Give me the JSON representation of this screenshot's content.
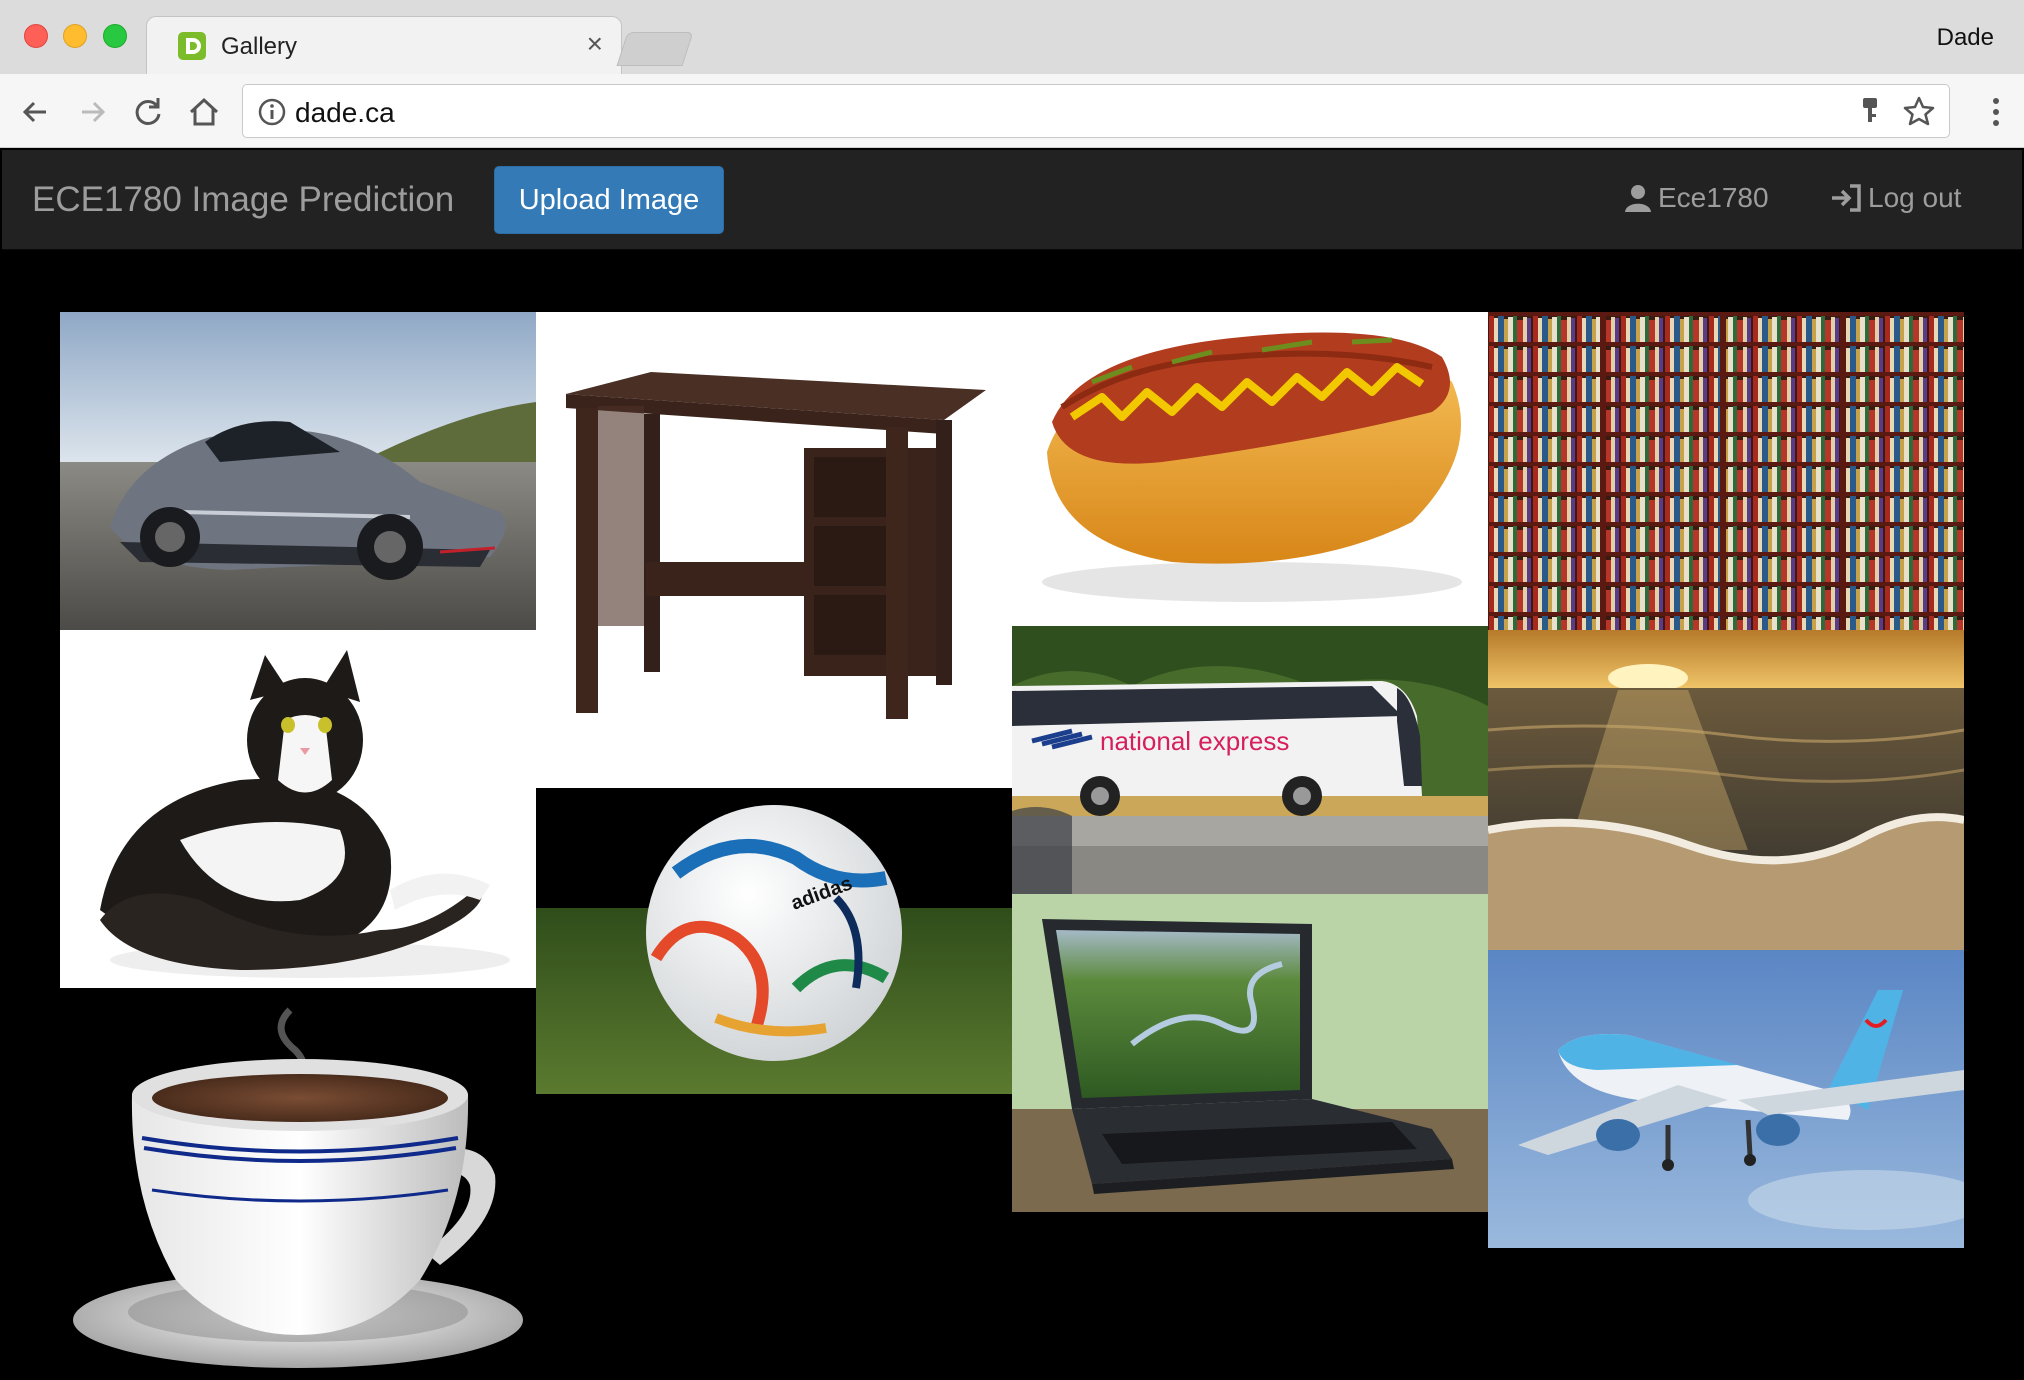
{
  "browser": {
    "tab_title": "Gallery",
    "tab_close": "×",
    "profile_name": "Dade",
    "url": "dade.ca"
  },
  "navbar": {
    "brand": "ECE1780 Image Prediction",
    "upload_label": "Upload Image",
    "user_label": "Ece1780",
    "logout_label": "Log out"
  },
  "gallery": {
    "bus_livery": "national express",
    "ball_brand": "adidas"
  },
  "colors": {
    "navbar_bg": "#222222",
    "primary_button": "#337ab7",
    "page_bg": "#000000"
  }
}
